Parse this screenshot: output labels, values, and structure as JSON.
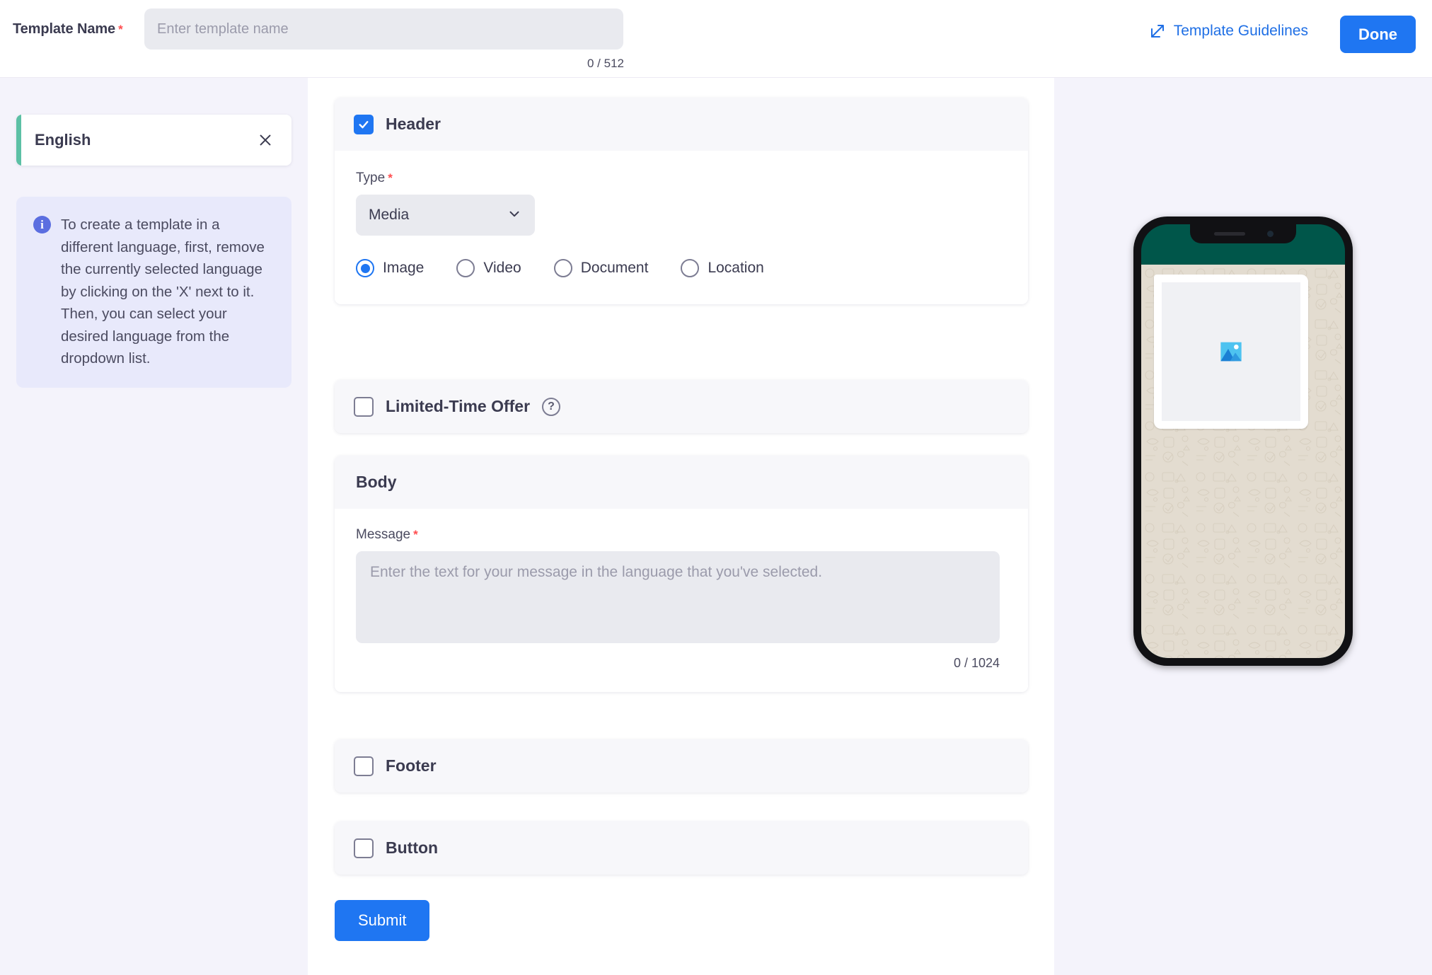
{
  "topbar": {
    "template_name_label": "Template Name",
    "required_mark": "*",
    "template_name_value": "",
    "template_name_placeholder": "Enter template name",
    "name_counter": "0 / 512",
    "guidelines_label": "Template Guidelines",
    "guidelines_icon": "external-link-icon",
    "done_label": "Done",
    "accent_color": "#1f76f2"
  },
  "sidebar": {
    "language": {
      "name": "English",
      "close_icon": "close-icon",
      "accent_color": "#5cc0a5"
    },
    "info": {
      "icon": "info-icon",
      "text": "To create a template in a different language, first, remove the currently selected language by clicking on the 'X' next to it. Then, you can select your desired language from the dropdown list.",
      "background_color": "#e8e9fb"
    }
  },
  "form": {
    "header_section": {
      "title": "Header",
      "checked": true,
      "type_label": "Type",
      "type_required": "*",
      "type_value": "Media",
      "chevron_icon": "chevron-down-icon",
      "media_options": [
        {
          "label": "Image",
          "selected": true
        },
        {
          "label": "Video",
          "selected": false
        },
        {
          "label": "Document",
          "selected": false
        },
        {
          "label": "Location",
          "selected": false
        }
      ]
    },
    "limited_time_offer": {
      "title": "Limited-Time Offer",
      "checked": false,
      "help_icon": "question-mark-icon",
      "help_glyph": "?"
    },
    "body_section": {
      "title": "Body",
      "message_label": "Message",
      "message_required": "*",
      "message_value": "",
      "message_placeholder": "Enter the text for your message in the language that you've selected.",
      "message_counter": "0 / 1024"
    },
    "footer_section": {
      "title": "Footer",
      "checked": false
    },
    "button_section": {
      "title": "Button",
      "checked": false
    },
    "submit_label": "Submit"
  },
  "preview": {
    "device": "phone-mockup",
    "header_bar_color": "#00564a",
    "chat_background_color": "#e3dcd0",
    "media_placeholder_icon": "image-placeholder-icon"
  }
}
